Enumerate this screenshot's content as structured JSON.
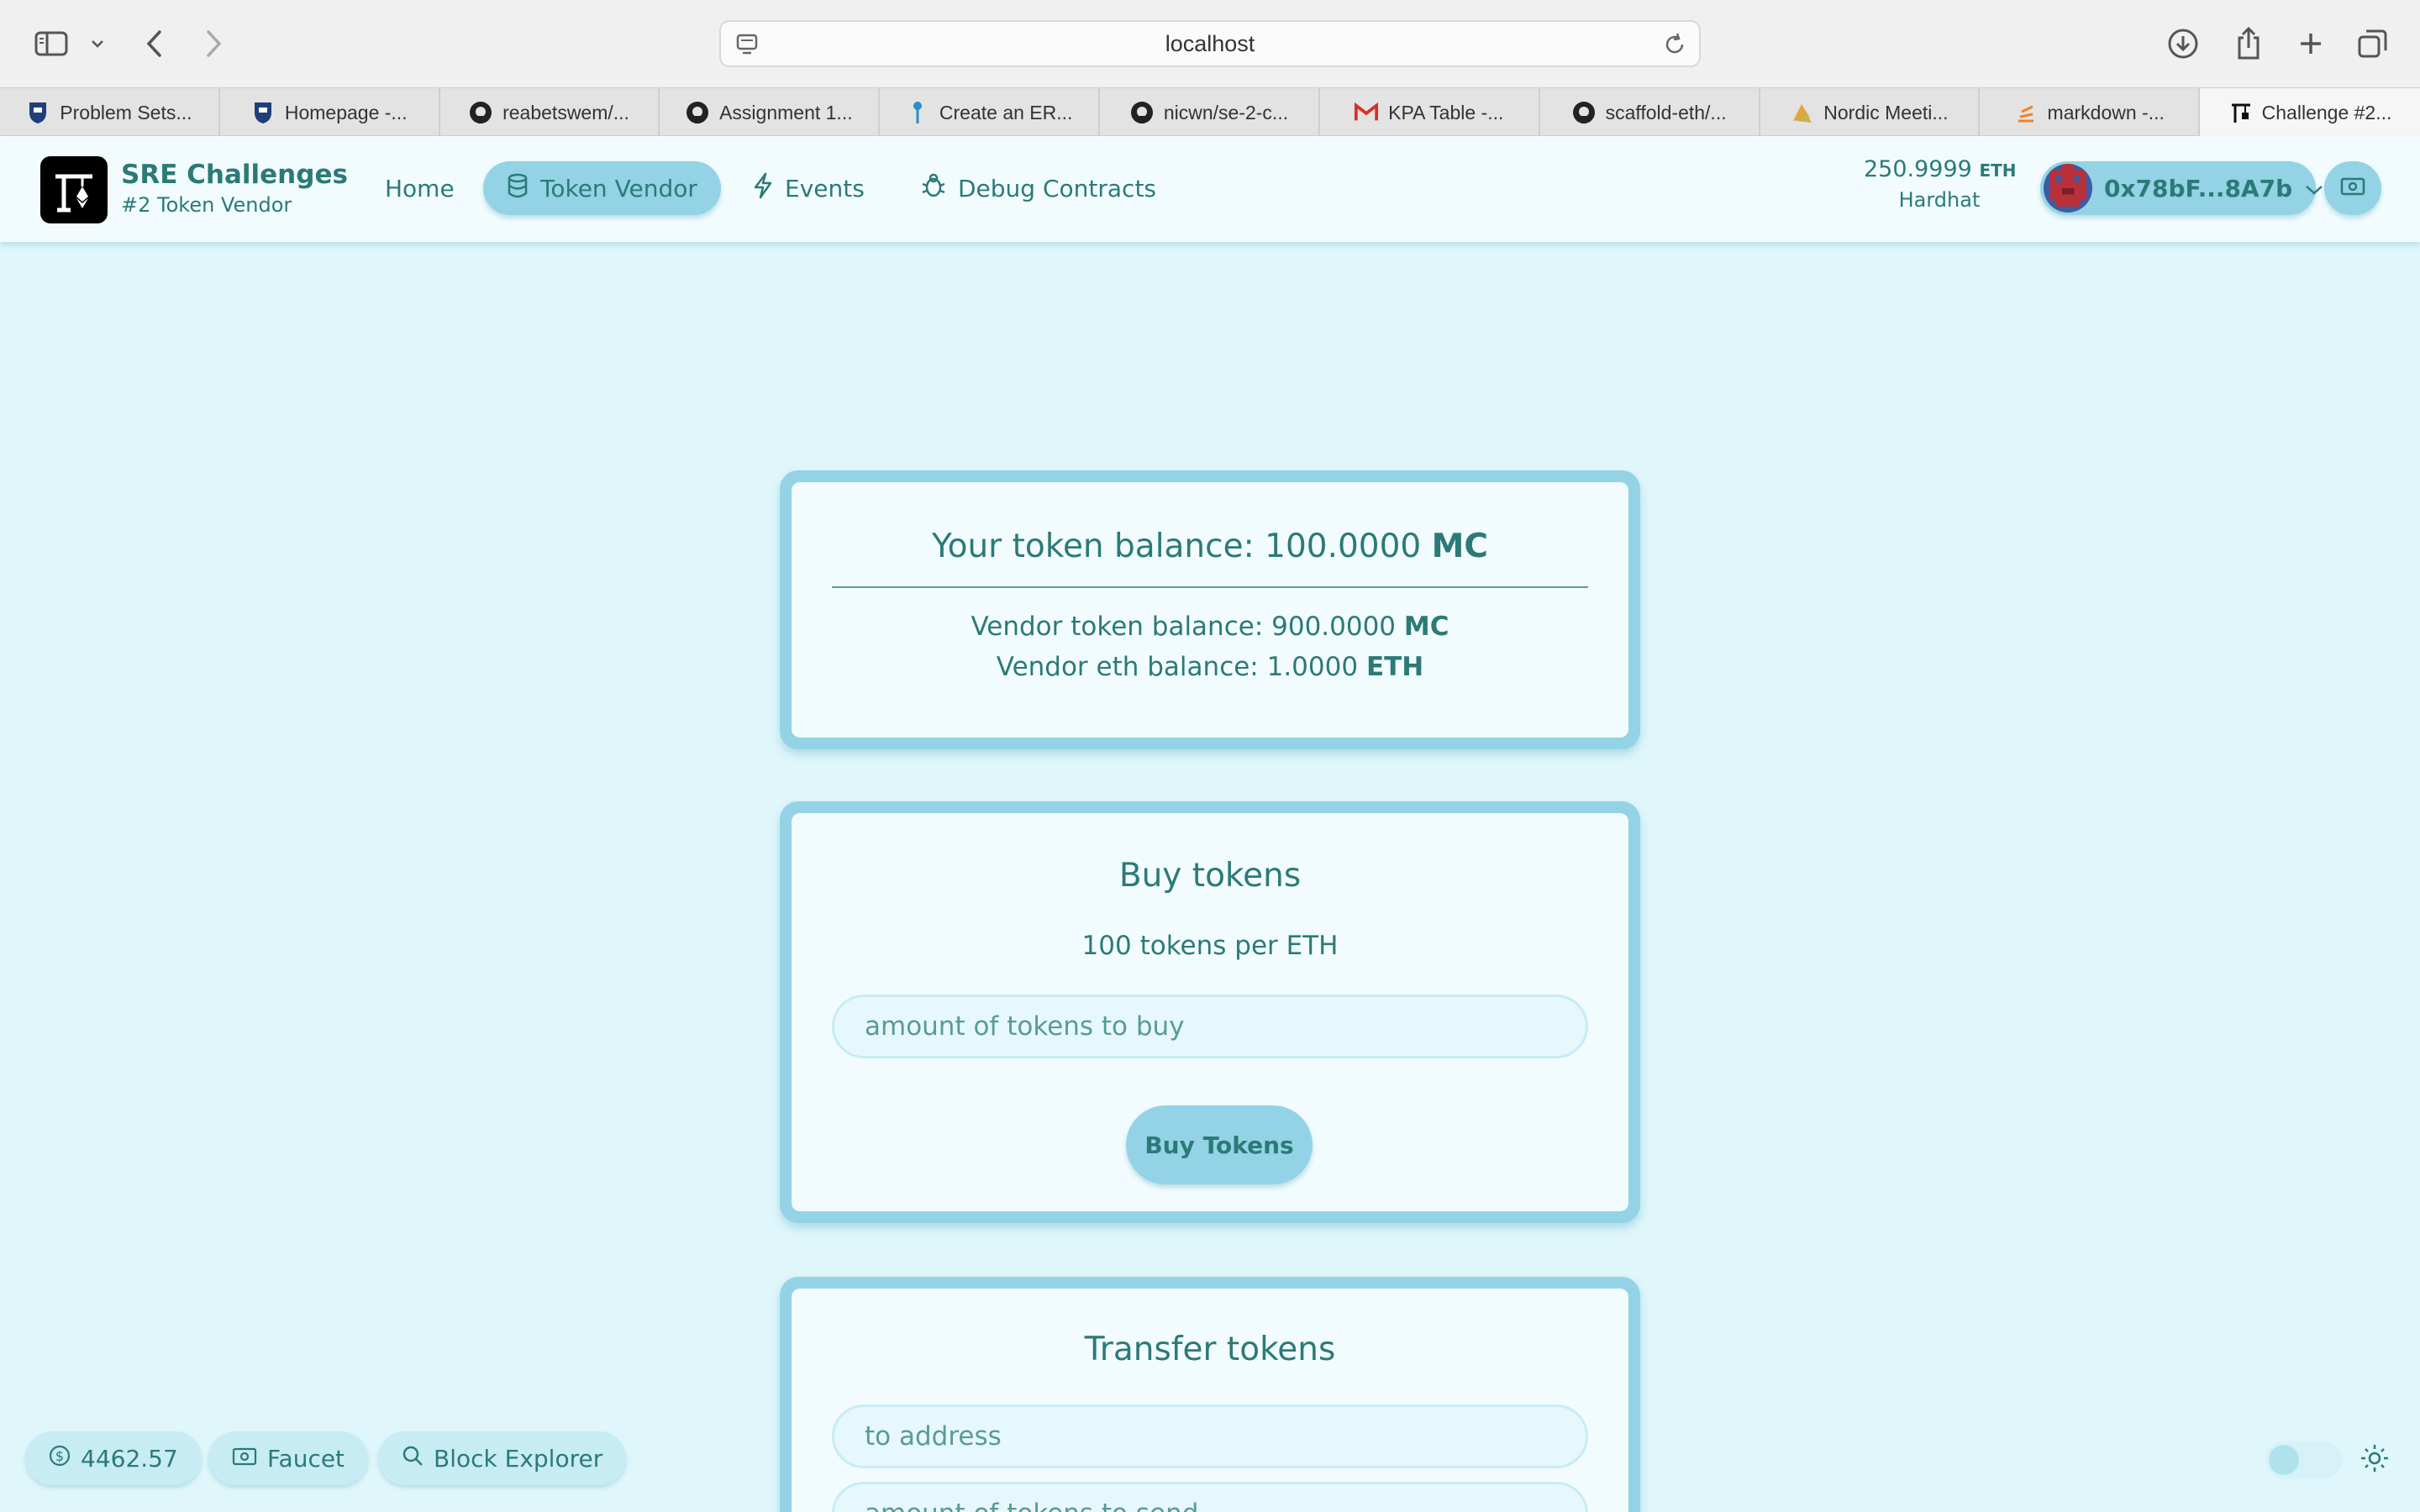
{
  "browser": {
    "url": "localhost",
    "tabs": [
      {
        "label": "Problem Sets...",
        "icon": "university-crest-icon"
      },
      {
        "label": "Homepage -...",
        "icon": "university-crest-icon"
      },
      {
        "label": "reabetswem/...",
        "icon": "github-icon"
      },
      {
        "label": "Assignment 1...",
        "icon": "github-icon"
      },
      {
        "label": "Create an ER...",
        "icon": "pin-icon"
      },
      {
        "label": "nicwn/se-2-c...",
        "icon": "github-icon"
      },
      {
        "label": "KPA Table -...",
        "icon": "gmail-icon"
      },
      {
        "label": "scaffold-eth/...",
        "icon": "github-icon"
      },
      {
        "label": "Nordic Meeti...",
        "icon": "bird-icon"
      },
      {
        "label": "markdown -...",
        "icon": "stack-icon"
      },
      {
        "label": "Challenge #2...",
        "icon": "crane-icon"
      }
    ]
  },
  "header": {
    "brand_title": "SRE Challenges",
    "brand_subtitle": "#2 Token Vendor",
    "nav": [
      {
        "label": "Home",
        "icon": ""
      },
      {
        "label": "Token Vendor",
        "icon": "database-icon"
      },
      {
        "label": "Events",
        "icon": "bolt-icon"
      },
      {
        "label": "Debug Contracts",
        "icon": "bug-icon"
      }
    ],
    "eth_balance": "250.9999",
    "eth_unit": "ETH",
    "network": "Hardhat",
    "account": "0x78bF...8A7b"
  },
  "balances_card": {
    "title_prefix": "Your token balance: 100.0000",
    "title_unit": "MC",
    "vendor_token_prefix": "Vendor token balance: 900.0000",
    "vendor_token_unit": "MC",
    "vendor_eth_prefix": "Vendor eth balance: 1.0000",
    "vendor_eth_unit": "ETH"
  },
  "buy_card": {
    "title": "Buy tokens",
    "rate": "100 tokens per ETH",
    "amount_placeholder": "amount of tokens to buy",
    "button": "Buy Tokens"
  },
  "transfer_card": {
    "title": "Transfer tokens",
    "address_placeholder": "to address",
    "amount_placeholder": "amount of tokens to send"
  },
  "footer": {
    "price": "4462.57",
    "faucet": "Faucet",
    "explorer": "Block Explorer"
  },
  "colors": {
    "background": "#dff6fb",
    "accent": "#93d3e5",
    "text": "#2b7a78"
  }
}
